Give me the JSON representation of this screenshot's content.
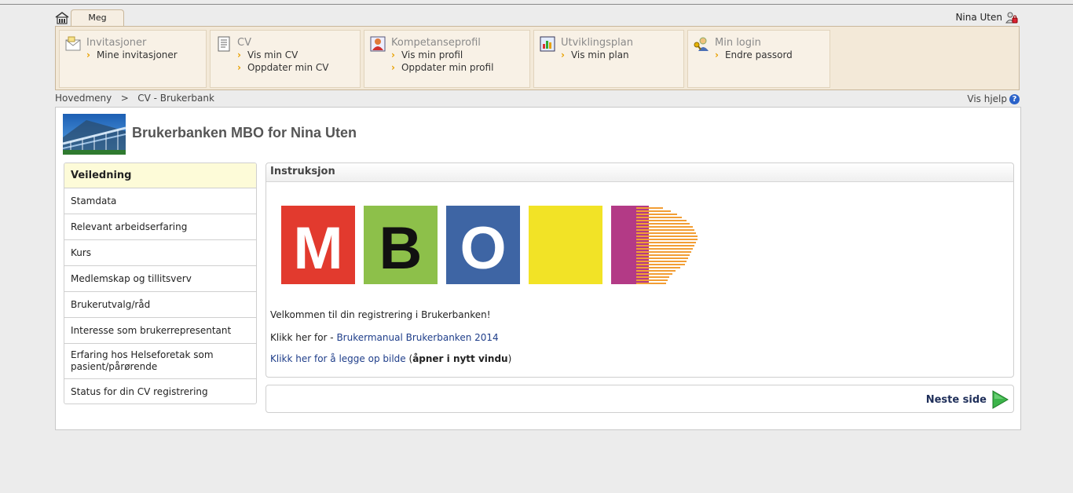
{
  "tabs": {
    "active_label": "Meg"
  },
  "user": {
    "name": "Nina Uten"
  },
  "menu": [
    {
      "title": "Invitasjoner",
      "links": [
        "Mine invitasjoner"
      ],
      "icon": "envelope-icon"
    },
    {
      "title": "CV",
      "links": [
        "Vis min CV",
        "Oppdater min CV"
      ],
      "icon": "document-icon"
    },
    {
      "title": "Kompetanseprofil",
      "links": [
        "Vis min profil",
        "Oppdater min profil"
      ],
      "icon": "person-card-icon"
    },
    {
      "title": "Utviklingsplan",
      "links": [
        "Vis min plan"
      ],
      "icon": "chart-board-icon"
    },
    {
      "title": "Min login",
      "links": [
        "Endre passord"
      ],
      "icon": "user-key-icon"
    }
  ],
  "breadcrumb": {
    "home": "Hovedmeny",
    "sep": ">",
    "current": "CV - Brukerbank"
  },
  "help": {
    "label": "Vis hjelp"
  },
  "page": {
    "title": "Brukerbanken MBO for Nina Uten"
  },
  "sidebar": {
    "items": [
      "Veiledning",
      "Stamdata",
      "Relevant arbeidserfaring",
      "Kurs",
      "Medlemskap og tillitsverv",
      "Brukerutvalg/råd",
      "Interesse som brukerrepresentant",
      "Erfaring hos Helseforetak som pasient/pårørende",
      "Status for din CV registrering"
    ],
    "active_index": 0
  },
  "instruction": {
    "heading": "Instruksjon",
    "logo_letters": [
      "M",
      "B",
      "O"
    ],
    "welcome": "Velkommen til din registrering i Brukerbanken!",
    "manual_prefix": "Klikk her for - ",
    "manual_link": "Brukermanual Brukerbanken 2014",
    "photo_link": "Klikk her for å legge op bilde",
    "photo_note_open": " (",
    "photo_note": "åpner i nytt vindu",
    "photo_note_close": ")"
  },
  "next": {
    "label": "Neste side"
  },
  "colors": {
    "logo_red": "#e23a2e",
    "logo_green": "#8dc04a",
    "logo_blue": "#3e65a4",
    "logo_yellow": "#f2e326",
    "logo_purple": "#b33a86",
    "logo_orange": "#f29e35",
    "accent_arrow": "#e8a000",
    "next_arrow": "#3cb44a"
  }
}
